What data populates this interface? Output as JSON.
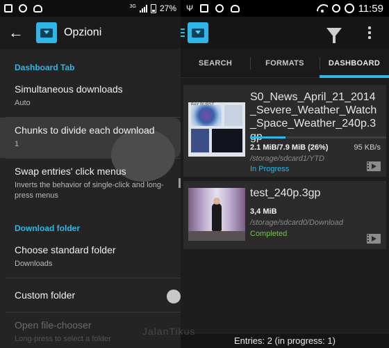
{
  "left": {
    "status": {
      "battery": "27%",
      "network": "3G"
    },
    "appbar": {
      "title": "Opzioni"
    },
    "section_dashboard": "Dashboard Tab",
    "prefs_dashboard": [
      {
        "title": "Simultaneous downloads",
        "summary": "Auto"
      },
      {
        "title": "Chunks to divide each download",
        "summary": "1"
      },
      {
        "title": "Swap entries' click menus",
        "summary": "Inverts the behavior of single-click and long-press menus"
      }
    ],
    "section_folder": "Download folder",
    "prefs_folder": [
      {
        "title": "Choose standard folder",
        "summary": "Downloads"
      },
      {
        "title": "Custom folder",
        "summary": ""
      },
      {
        "title": "Open file-chooser",
        "summary": "Long-press to select a folder"
      }
    ]
  },
  "right": {
    "status": {
      "time": "11:59"
    },
    "tabs": [
      "SEARCH",
      "FORMATS",
      "DASHBOARD"
    ],
    "active_tab": "DASHBOARD",
    "downloads": [
      {
        "filename": "S0_News_April_21_2014_Severe_Weather_Watch_Space_Weather_240p.3gp",
        "size": "2.1 MiB/7.9 MiB (26%)",
        "speed": "95 KB/s",
        "path": "/storage/sdcard1/YTD",
        "status": "In Progress",
        "progress": 0.26,
        "thumb_caption": "BAY BURST"
      },
      {
        "filename": "test_240p.3gp",
        "size": "3,4 MiB",
        "path": "/storage/sdcard0/Download",
        "status": "Completed"
      }
    ],
    "footer": "Entries: 2 (in progress: 1)"
  },
  "watermark": "JalanTikus",
  "colors": {
    "accent": "#33b5e5",
    "completed": "#76c24a"
  }
}
